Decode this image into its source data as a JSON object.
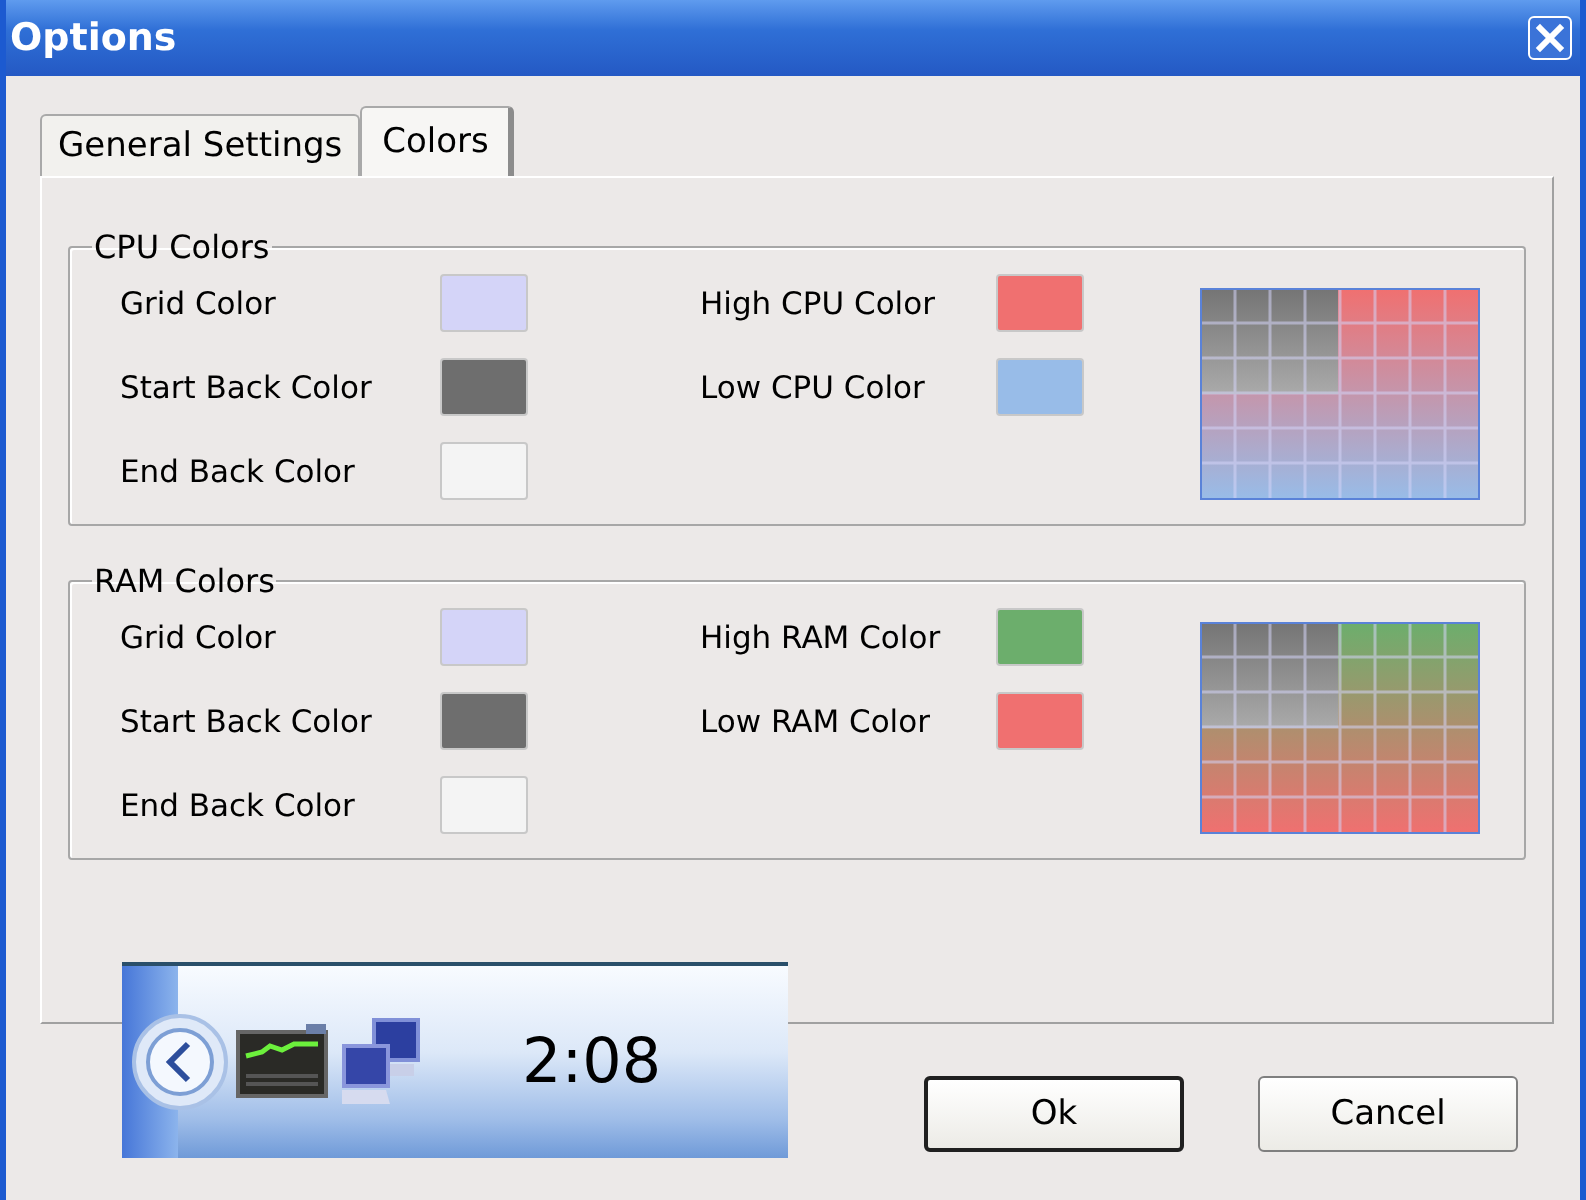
{
  "window": {
    "title": "Options"
  },
  "tabs": [
    {
      "label": "General Settings",
      "selected": false
    },
    {
      "label": "Colors",
      "selected": true
    }
  ],
  "groups": [
    {
      "title": "CPU Colors",
      "general_colors": [
        {
          "label": "Grid Color",
          "color": "#d4d4f8"
        },
        {
          "label": "Start Back Color",
          "color": "#6e6e6e"
        },
        {
          "label": "End Back Color",
          "color": "#f4f4f4"
        }
      ],
      "load_colors": [
        {
          "label": "High CPU Color",
          "color": "#f07070"
        },
        {
          "label": "Low CPU Color",
          "color": "#98bce8"
        }
      ]
    },
    {
      "title": "RAM Colors",
      "general_colors": [
        {
          "label": "Grid Color",
          "color": "#d4d4f8"
        },
        {
          "label": "Start Back Color",
          "color": "#6e6e6e"
        },
        {
          "label": "End Back Color",
          "color": "#f4f4f4"
        }
      ],
      "load_colors": [
        {
          "label": "High RAM Color",
          "color": "#6cae6c"
        },
        {
          "label": "Low RAM Color",
          "color": "#f07070"
        }
      ]
    }
  ],
  "taskbar_preview": {
    "clock": "2:08"
  },
  "buttons": [
    "Ok",
    "Cancel"
  ]
}
